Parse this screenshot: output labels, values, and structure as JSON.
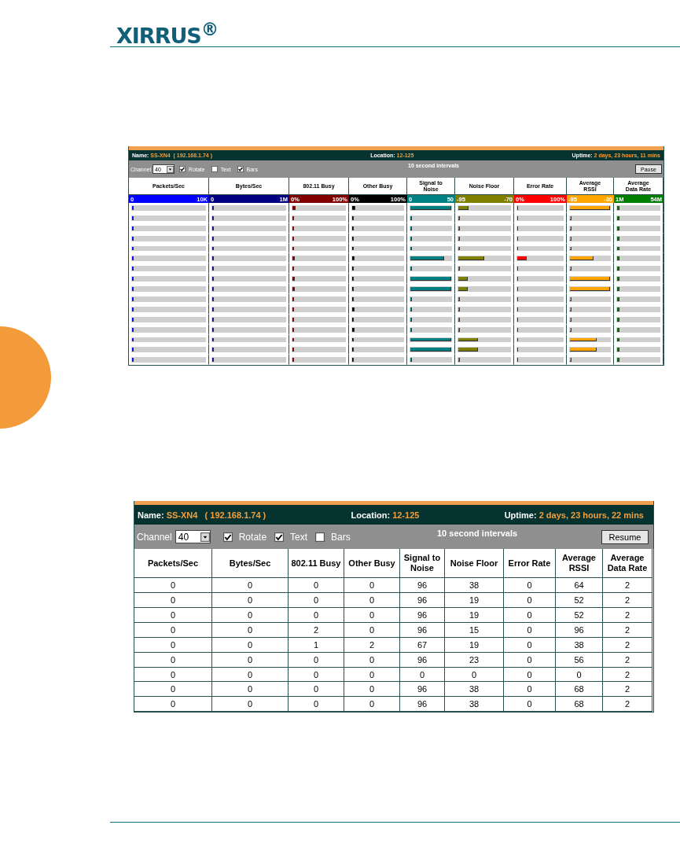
{
  "header": {
    "logo": "XIRRUS$^{®}$"
  },
  "bars_view": {
    "name_label": "Name:",
    "name": "SS-XN4",
    "ip": "( 192.168.1.74 )",
    "location_label": "Location:",
    "location": "12-125",
    "uptime_label": "Uptime:",
    "uptime": "2 days, 23 hours, 11 mins",
    "channel_label": "Channel",
    "channel": "40",
    "options": [
      {
        "label": "Rotate",
        "checked": true
      },
      {
        "label": "Text",
        "checked": false
      },
      {
        "label": "Bars",
        "checked": true
      }
    ],
    "interval": "10 second intervals",
    "button": "Pause",
    "columns": [
      {
        "label": "Packets/Sec",
        "min": "0",
        "max": "10K",
        "color": "#0000ff"
      },
      {
        "label": "Bytes/Sec",
        "min": "0",
        "max": "1M",
        "color": "#000080"
      },
      {
        "label": "802.11 Busy",
        "min": "0%",
        "max": "100%",
        "color": "#800000"
      },
      {
        "label": "Other Busy",
        "min": "0%",
        "max": "100%",
        "color": "#000000"
      },
      {
        "label": "Signal to Noise",
        "min": "0",
        "max": "50",
        "color": "#008080"
      },
      {
        "label": "Noise Floor",
        "min": "-95",
        "max": "-70",
        "color": "#808000"
      },
      {
        "label": "Error Rate",
        "min": "0%",
        "max": "100%",
        "color": "#ff0000"
      },
      {
        "label": "Average RSSI",
        "min": "-95",
        "max": "-30",
        "color": "#ffa500"
      },
      {
        "label": "Average Data Rate",
        "min": "1M",
        "max": "54M",
        "color": "#008000"
      }
    ],
    "rows": [
      {
        "cells": [
          {
            "level": 0.02
          },
          {
            "level": 0.02
          },
          {
            "level": 0.06
          },
          {
            "level": 0.06
          },
          {
            "level": 1
          },
          {
            "level": 0.2
          },
          {
            "level": 0.02
          },
          {
            "level": 1
          },
          {
            "level": 0.05
          }
        ]
      },
      {
        "cells": [
          {
            "level": 0.02
          },
          {
            "level": 0.02
          },
          {
            "level": 0.03
          },
          {
            "level": 0.03
          },
          {
            "level": 0.03
          },
          {
            "level": 0.03
          },
          {
            "level": 0.02
          },
          {
            "level": 0.03
          },
          {
            "level": 0.05
          }
        ]
      },
      {
        "cells": [
          {
            "level": 0.02
          },
          {
            "level": 0.02
          },
          {
            "level": 0.03
          },
          {
            "level": 0.03
          },
          {
            "level": 0.03
          },
          {
            "level": 0.03
          },
          {
            "level": 0.02
          },
          {
            "level": 0.03
          },
          {
            "level": 0.05
          }
        ]
      },
      {
        "cells": [
          {
            "level": 0.02
          },
          {
            "level": 0.02
          },
          {
            "level": 0.03
          },
          {
            "level": 0.03
          },
          {
            "level": 0.03
          },
          {
            "level": 0.03
          },
          {
            "level": 0.02
          },
          {
            "level": 0.03
          },
          {
            "level": 0.05
          }
        ]
      },
      {
        "cells": [
          {
            "level": 0.02
          },
          {
            "level": 0.02
          },
          {
            "level": 0.03
          },
          {
            "level": 0.03
          },
          {
            "level": 0.03
          },
          {
            "level": 0.03
          },
          {
            "level": 0.02
          },
          {
            "level": 0.03
          },
          {
            "level": 0.05
          }
        ]
      },
      {
        "cells": [
          {
            "level": 0.02
          },
          {
            "level": 0.02
          },
          {
            "level": 0.04
          },
          {
            "level": 0.04
          },
          {
            "level": 0.83
          },
          {
            "level": 0.5
          },
          {
            "level": 0.2
          },
          {
            "level": 0.58
          },
          {
            "level": 0.05
          }
        ]
      },
      {
        "cells": [
          {
            "level": 0.02
          },
          {
            "level": 0.02
          },
          {
            "level": 0.03
          },
          {
            "level": 0.03
          },
          {
            "level": 0.03
          },
          {
            "level": 0.03
          },
          {
            "level": 0.02
          },
          {
            "level": 0.03
          },
          {
            "level": 0.05
          }
        ]
      },
      {
        "cells": [
          {
            "level": 0.02
          },
          {
            "level": 0.02
          },
          {
            "level": 0.05
          },
          {
            "level": 0.03
          },
          {
            "level": 1
          },
          {
            "level": 0.18
          },
          {
            "level": 0.02
          },
          {
            "level": 1
          },
          {
            "level": 0.05
          }
        ]
      },
      {
        "cells": [
          {
            "level": 0.02
          },
          {
            "level": 0.02
          },
          {
            "level": 0.05
          },
          {
            "level": 0.03
          },
          {
            "level": 1
          },
          {
            "level": 0.18
          },
          {
            "level": 0.02
          },
          {
            "level": 1
          },
          {
            "level": 0.05
          }
        ]
      },
      {
        "cells": [
          {
            "level": 0.02
          },
          {
            "level": 0.02
          },
          {
            "level": 0.03
          },
          {
            "level": 0.03
          },
          {
            "level": 0.03
          },
          {
            "level": 0.03
          },
          {
            "level": 0.02
          },
          {
            "level": 0.03
          },
          {
            "level": 0.05
          }
        ]
      },
      {
        "cells": [
          {
            "level": 0.02
          },
          {
            "level": 0.02
          },
          {
            "level": 0.03
          },
          {
            "level": 0.04
          },
          {
            "level": 0.03
          },
          {
            "level": 0.03
          },
          {
            "level": 0.02
          },
          {
            "level": 0.03
          },
          {
            "level": 0.05
          }
        ]
      },
      {
        "cells": [
          {
            "level": 0.02
          },
          {
            "level": 0.02
          },
          {
            "level": 0.03
          },
          {
            "level": 0.03
          },
          {
            "level": 0.03
          },
          {
            "level": 0.03
          },
          {
            "level": 0.02
          },
          {
            "level": 0.03
          },
          {
            "level": 0.05
          }
        ]
      },
      {
        "cells": [
          {
            "level": 0.02
          },
          {
            "level": 0.02
          },
          {
            "level": 0.03
          },
          {
            "level": 0.04
          },
          {
            "level": 0.03
          },
          {
            "level": 0.03
          },
          {
            "level": 0.02
          },
          {
            "level": 0.03
          },
          {
            "level": 0.05
          }
        ]
      },
      {
        "cells": [
          {
            "level": 0.02
          },
          {
            "level": 0.02
          },
          {
            "level": 0.03
          },
          {
            "level": 0.03
          },
          {
            "level": 1
          },
          {
            "level": 0.38
          },
          {
            "level": 0.02
          },
          {
            "level": 0.66
          },
          {
            "level": 0.05
          }
        ]
      },
      {
        "cells": [
          {
            "level": 0.02
          },
          {
            "level": 0.02
          },
          {
            "level": 0.03
          },
          {
            "level": 0.03
          },
          {
            "level": 1
          },
          {
            "level": 0.38
          },
          {
            "level": 0.02
          },
          {
            "level": 0.66
          },
          {
            "level": 0.05
          }
        ]
      },
      {
        "cells": [
          {
            "level": 0.02
          },
          {
            "level": 0.02
          },
          {
            "level": 0.03
          },
          {
            "level": 0.03
          },
          {
            "level": 0.03
          },
          {
            "level": 0.03
          },
          {
            "level": 0.02
          },
          {
            "level": 0.03
          },
          {
            "level": 0.05
          }
        ]
      }
    ]
  },
  "text_view": {
    "name_label": "Name:",
    "name": "SS-XN4",
    "ip": "( 192.168.1.74 )",
    "location_label": "Location:",
    "location": "12-125",
    "uptime_label": "Uptime:",
    "uptime": "2 days, 23 hours, 22 mins",
    "channel_label": "Channel",
    "channel": "40",
    "options": [
      {
        "label": "Rotate",
        "checked": true
      },
      {
        "label": "Text",
        "checked": true
      },
      {
        "label": "Bars",
        "checked": false
      }
    ],
    "interval": "10 second intervals",
    "button": "Resume",
    "columns": [
      "Packets/Sec",
      "Bytes/Sec",
      "802.11 Busy",
      "Other Busy",
      "Signal to Noise",
      "Noise Floor",
      "Error Rate",
      "Average RSSI",
      "Average Data Rate"
    ],
    "rows": [
      [
        "0",
        "0",
        "0",
        "0",
        "96",
        "38",
        "0",
        "64",
        "2"
      ],
      [
        "0",
        "0",
        "0",
        "0",
        "96",
        "19",
        "0",
        "52",
        "2"
      ],
      [
        "0",
        "0",
        "0",
        "0",
        "96",
        "19",
        "0",
        "52",
        "2"
      ],
      [
        "0",
        "0",
        "2",
        "0",
        "96",
        "15",
        "0",
        "96",
        "2"
      ],
      [
        "0",
        "0",
        "1",
        "2",
        "67",
        "19",
        "0",
        "38",
        "2"
      ],
      [
        "0",
        "0",
        "0",
        "0",
        "96",
        "23",
        "0",
        "56",
        "2"
      ],
      [
        "0",
        "0",
        "0",
        "0",
        "0",
        "0",
        "0",
        "0",
        "2"
      ],
      [
        "0",
        "0",
        "0",
        "0",
        "96",
        "38",
        "0",
        "68",
        "2"
      ],
      [
        "0",
        "0",
        "0",
        "0",
        "96",
        "38",
        "0",
        "68",
        "2"
      ]
    ]
  }
}
